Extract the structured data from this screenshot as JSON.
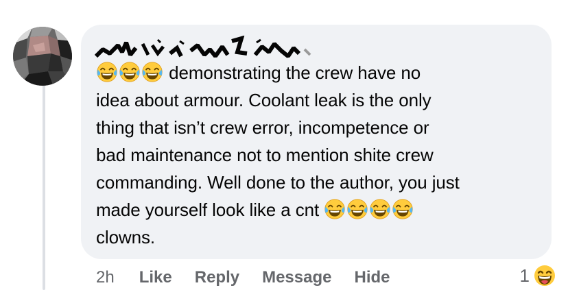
{
  "comment": {
    "text_lines": [
      "demonstrating the crew have no",
      "idea about armour. Coolant leak is the only",
      "thing that isn’t crew error, incompetence or",
      "bad maintenance not to mention shite crew",
      "commanding. Well done to the author, you just",
      "made yourself look like a cnt",
      "clowns."
    ],
    "leading_emoji": "face-with-tears-of-joy-icon",
    "trailing_emoji": "face-with-tears-of-joy-icon"
  },
  "actions": {
    "time": "2h",
    "like": "Like",
    "reply": "Reply",
    "message": "Message",
    "hide": "Hide"
  },
  "reactions": {
    "count": "1",
    "icon": "laughing-face-icon"
  },
  "colors": {
    "bubble": "#f0f2f5",
    "action_text": "#65676b",
    "emoji_yellow": "#ffcc3d",
    "tear_blue": "#57b7f0"
  }
}
